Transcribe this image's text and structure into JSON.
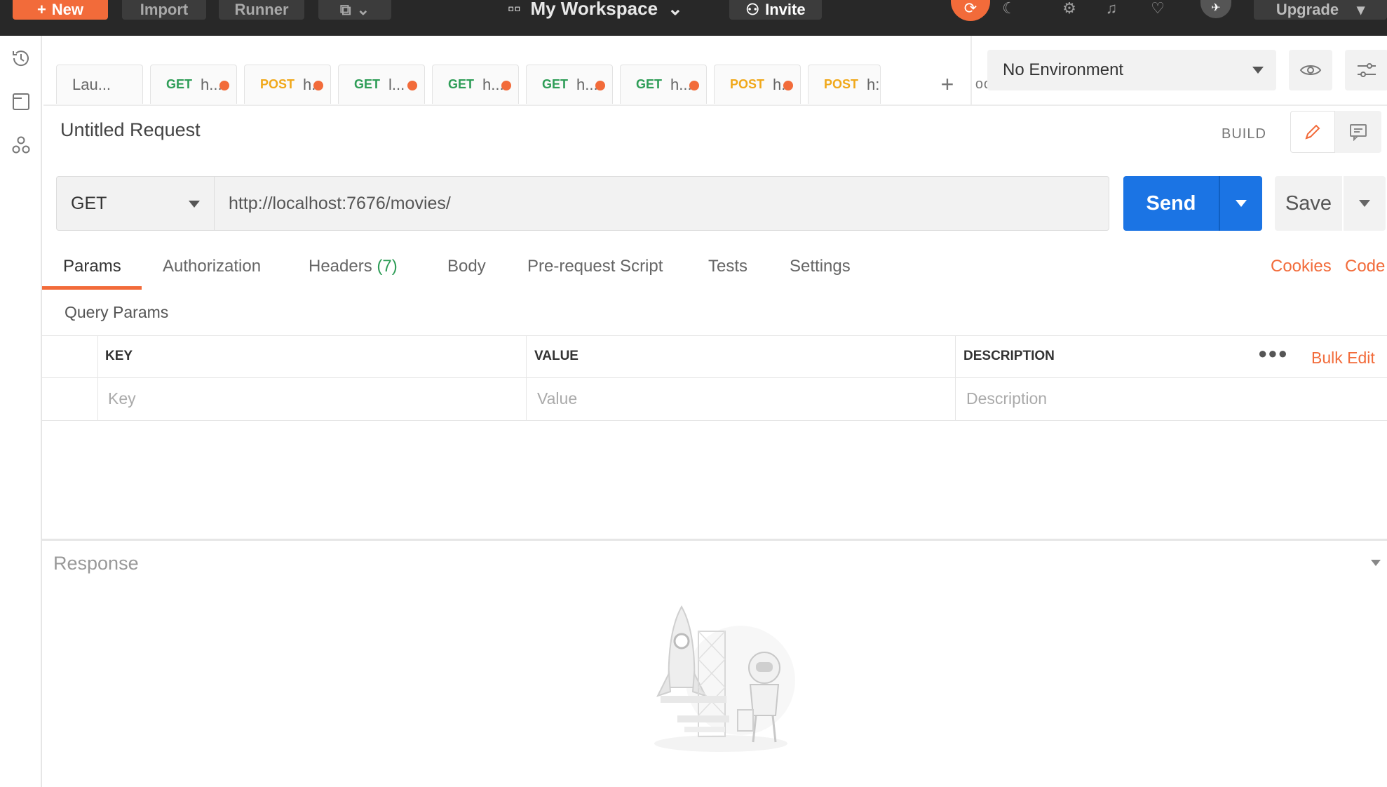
{
  "topbar": {
    "new_label": "New",
    "import_label": "Import",
    "runner_label": "Runner",
    "workspace_label": "My Workspace",
    "invite_label": "Invite",
    "upgrade_label": "Upgrade"
  },
  "tabs": [
    {
      "method": "",
      "label": "Lau..."
    },
    {
      "method": "GET",
      "label": "h..."
    },
    {
      "method": "POST",
      "label": "h."
    },
    {
      "method": "GET",
      "label": "l..."
    },
    {
      "method": "GET",
      "label": "h..."
    },
    {
      "method": "GET",
      "label": "h..."
    },
    {
      "method": "GET",
      "label": "h..."
    },
    {
      "method": "POST",
      "label": "h."
    },
    {
      "method": "POST",
      "label": "h:"
    }
  ],
  "environment": {
    "selected": "No Environment"
  },
  "request": {
    "title": "Untitled Request",
    "mode_label": "BUILD",
    "method": "GET",
    "url": "http://localhost:7676/movies/",
    "send_label": "Send",
    "save_label": "Save"
  },
  "subtabs": {
    "params": "Params",
    "authorization": "Authorization",
    "headers": "Headers",
    "headers_count": "(7)",
    "body": "Body",
    "prerequest": "Pre-request Script",
    "tests": "Tests",
    "settings": "Settings",
    "cookies": "Cookies",
    "code": "Code"
  },
  "params": {
    "section_label": "Query Params",
    "col_key": "KEY",
    "col_value": "VALUE",
    "col_description": "DESCRIPTION",
    "bulk_edit": "Bulk Edit",
    "key_placeholder": "Key",
    "value_placeholder": "Value",
    "description_placeholder": "Description"
  },
  "response": {
    "label": "Response"
  },
  "colors": {
    "accent": "#f26b3a",
    "primary": "#1b74e4",
    "get": "#2e9d57",
    "post": "#f0a81a"
  }
}
